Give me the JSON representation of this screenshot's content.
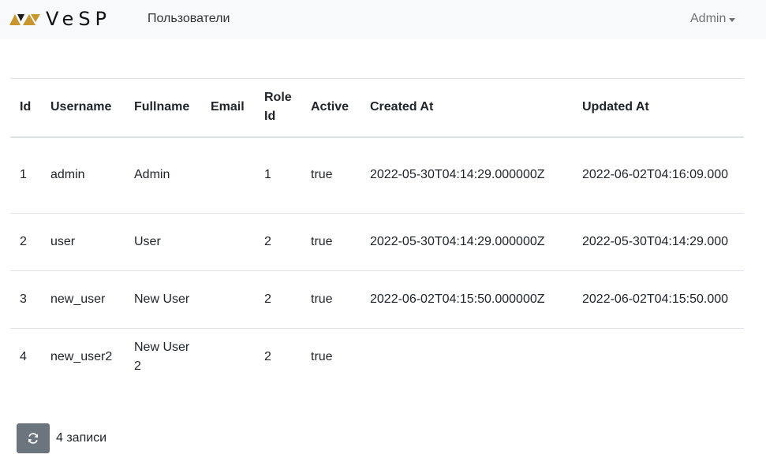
{
  "brand": {
    "name": "VeSP",
    "logo_colors": [
      "#c8962d",
      "#1a1a1a"
    ]
  },
  "navbar": {
    "users_link": "Пользователи",
    "user_menu": "Admin"
  },
  "table": {
    "headers": {
      "id": "Id",
      "username": "Username",
      "fullname": "Fullname",
      "email": "Email",
      "role_id": "Role Id",
      "active": "Active",
      "created_at": "Created At",
      "updated_at": "Updated At"
    },
    "rows": [
      {
        "id": "1",
        "username": "admin",
        "fullname": "Admin",
        "email": "",
        "role_id": "1",
        "active": "true",
        "created_at": "2022-05-30T04:14:29.000000Z",
        "updated_at": "2022-06-02T04:16:09.000"
      },
      {
        "id": "2",
        "username": "user",
        "fullname": "User",
        "email": "",
        "role_id": "2",
        "active": "true",
        "created_at": "2022-05-30T04:14:29.000000Z",
        "updated_at": "2022-05-30T04:14:29.000"
      },
      {
        "id": "3",
        "username": "new_user",
        "fullname": "New User",
        "email": "",
        "role_id": "2",
        "active": "true",
        "created_at": "2022-06-02T04:15:50.000000Z",
        "updated_at": "2022-06-02T04:15:50.000"
      },
      {
        "id": "4",
        "username": "new_user2",
        "fullname": "New User 2",
        "email": "",
        "role_id": "2",
        "active": "true",
        "created_at": "",
        "updated_at": ""
      }
    ]
  },
  "footer": {
    "refresh_icon": "refresh-icon",
    "count_label": "4 записи",
    "button_color": "#6c757d"
  }
}
